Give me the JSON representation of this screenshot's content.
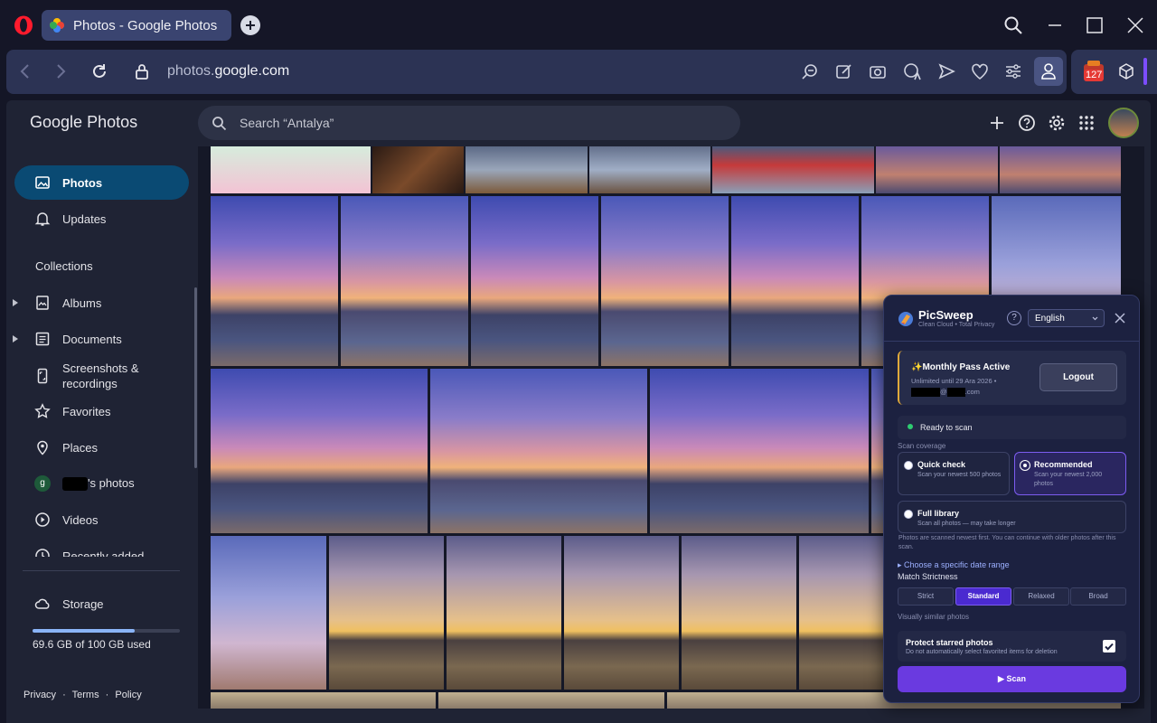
{
  "browser": {
    "tab_title": "Photos - Google Photos",
    "url_prefix": "photos.",
    "url_domain": "google.com",
    "extension_badge": "127"
  },
  "app": {
    "logo_google": "Google",
    "logo_photos": "Photos",
    "search_placeholder": "Search “Antalya”"
  },
  "sidebar": {
    "items": [
      {
        "label": "Photos",
        "icon": "photo-icon"
      },
      {
        "label": "Updates",
        "icon": "bell-icon"
      }
    ],
    "collections_heading": "Collections",
    "collections": [
      {
        "label": "Albums",
        "icon": "album-icon"
      },
      {
        "label": "Documents",
        "icon": "document-icon"
      },
      {
        "label": "Screenshots &",
        "label2": "recordings",
        "icon": "screenshot-icon"
      },
      {
        "label": "Favorites",
        "icon": "star-icon"
      },
      {
        "label": "Places",
        "icon": "pin-icon"
      },
      {
        "label": "'s photos",
        "avatar_letter": "g",
        "icon": "person-avatar"
      },
      {
        "label": "Videos",
        "icon": "play-icon"
      },
      {
        "label": "Recently added",
        "icon": "clock-icon"
      }
    ],
    "storage_label": "Storage",
    "storage_used": "69.6 GB of 100 GB used",
    "storage_fraction": 0.696,
    "footer": [
      "Privacy",
      "Terms",
      "Policy"
    ],
    "footer_sep": "·"
  },
  "picsweep": {
    "title": "PicSweep",
    "tagline": "Clean Cloud • Total Privacy",
    "help": "?",
    "language": "English",
    "pass_title": "✨Monthly Pass Active",
    "pass_sub": "Unlimited until 29 Ara 2026 •",
    "pass_email_suffix": ".com",
    "pass_email_at": "@",
    "logout": "Logout",
    "status": "Ready to scan",
    "scan_coverage_label": "Scan coverage",
    "options": [
      {
        "title": "Quick check",
        "desc": "Scan your newest 500 photos"
      },
      {
        "title": "Recommended",
        "desc": "Scan your newest 2,000 photos"
      },
      {
        "title": "Full library",
        "desc": "Scan all photos — may take longer"
      }
    ],
    "note": "Photos are scanned newest first. You can continue with older photos after this scan.",
    "date_range": "▸ Choose a specific date range",
    "match_label": "Match Strictness",
    "strictness": [
      "Strict",
      "Standard",
      "Relaxed",
      "Broad"
    ],
    "strictness_hint": "Visually similar photos",
    "protect_title": "Protect starred photos",
    "protect_desc": "Do not automatically select favorited items for deletion",
    "scan_button": "▶ Scan",
    "accent": "#6a3ae0"
  }
}
